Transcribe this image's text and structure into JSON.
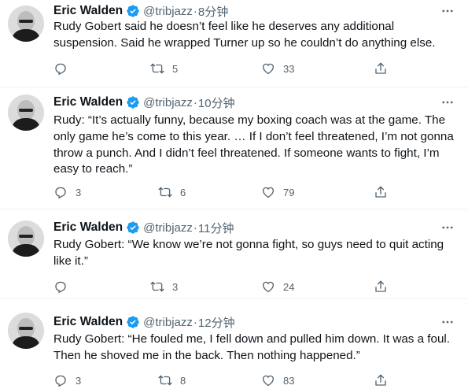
{
  "tweets": [
    {
      "author": "Eric Walden",
      "handle": "@tribjazz",
      "separator": "·",
      "time": "8分钟",
      "text": "Rudy Gobert said he doesn’t feel like he deserves any additional suspension. Said he wrapped Turner up so he couldn’t do anything else.",
      "replies": "",
      "retweets": "5",
      "likes": "33"
    },
    {
      "author": "Eric Walden",
      "handle": "@tribjazz",
      "separator": "·",
      "time": "10分钟",
      "text": "Rudy: “It’s actually funny, because my boxing coach was at the game. The only game he’s come to this year. … If I don’t feel threatened, I’m not gonna throw a punch. And I didn’t feel threatened. If someone wants to fight, I’m easy to reach.”",
      "replies": "3",
      "retweets": "6",
      "likes": "79"
    },
    {
      "author": "Eric Walden",
      "handle": "@tribjazz",
      "separator": "·",
      "time": "11分钟",
      "text": "Rudy Gobert: “We know we’re not gonna fight, so guys need to quit acting like it.”",
      "replies": "",
      "retweets": "3",
      "likes": "24"
    },
    {
      "author": "Eric Walden",
      "handle": "@tribjazz",
      "separator": "·",
      "time": "12分钟",
      "text": "Rudy Gobert: “He fouled me, I fell down and pulled him down. It was a foul. Then he shoved me in the back. Then nothing happened.”",
      "replies": "3",
      "retweets": "8",
      "likes": "83"
    }
  ],
  "colors": {
    "verified": "#1d9bf0",
    "muted": "#536471",
    "text": "#0f1419",
    "divider": "#eff3f4"
  },
  "icons": {
    "reply": "reply-icon",
    "retweet": "retweet-icon",
    "like": "like-icon",
    "share": "share-icon",
    "more": "more-icon",
    "verified": "verified-badge-icon"
  }
}
